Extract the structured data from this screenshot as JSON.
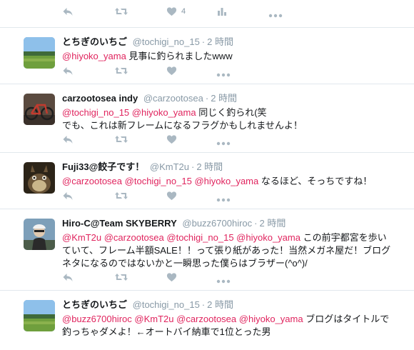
{
  "top_actions": {
    "like_count": "4"
  },
  "tweets": [
    {
      "name": "とちぎのいちご",
      "handle": "@tochigi_no_15",
      "time": "2 時間",
      "mentions": [
        "@hiyoko_yama"
      ],
      "text": "見事に釣られましたwww",
      "avatar": "field-landscape"
    },
    {
      "name": "carzootosea indy",
      "handle": "@carzootosea",
      "time": "2 時間",
      "mentions": [
        "@tochigi_no_15",
        "@hiyoko_yama"
      ],
      "text": "同じく釣られ(笑",
      "text2": "でも、これは新フレームになるフラグかもしれませんよ！",
      "avatar": "bicycle"
    },
    {
      "name": "Fuji33@餃子です！",
      "handle": "@KmT2u",
      "time": "2 時間",
      "mentions": [
        "@carzootosea",
        "@tochigi_no_15",
        "@hiyoko_yama"
      ],
      "text": "なるほど、そっちですね！",
      "avatar": "totoro"
    },
    {
      "name": "Hiro-C@Team SKYBERRY",
      "handle": "@buzz6700hiroc",
      "time": "2 時間",
      "mentions": [
        "@KmT2u",
        "@carzootosea",
        "@tochigi_no_15",
        "@hiyoko_yama"
      ],
      "text": "この前宇都宮を歩い",
      "text2": "ていて、フレーム半額SALE！！って張り紙があった！当然メガネ屋だ！ブログ",
      "text3": "ネタになるのではないかと一瞬思った僕らはブラザー(^o^)/",
      "avatar": "cyclist"
    },
    {
      "name": "とちぎのいちご",
      "handle": "@tochigi_no_15",
      "time": "2 時間",
      "mentions": [
        "@buzz6700hiroc",
        "@KmT2u",
        "@carzootosea",
        "@hiyoko_yama"
      ],
      "text": "ブログはタイトルで",
      "text2": "釣っちゃダメよ！←オートバイ納車で1位とった男",
      "avatar": "field-landscape"
    }
  ],
  "colors": {
    "mention": "#e0245e",
    "muted": "#8899a6",
    "icon": "#aab8c2",
    "border": "#e1e8ed"
  }
}
